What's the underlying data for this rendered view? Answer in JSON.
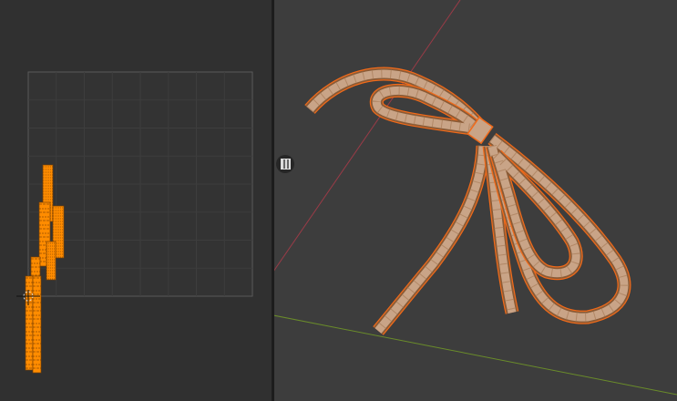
{
  "editors": {
    "left": {
      "type": "uv-editor",
      "background": "#303030",
      "grid_color": "#454545",
      "uv_island_color": "#ff8c00"
    },
    "right": {
      "type": "3d-viewport",
      "background": "#3d3d3d",
      "x_axis_color": "#9a3b47",
      "y_axis_color": "#6a8c2a",
      "mesh_fill": "#c9a487",
      "selection_outline": "#f06a1a"
    }
  },
  "icons": {
    "viewport_overlay_toggle": "checker-texture-icon",
    "cursor": "2d-cursor-icon"
  },
  "colors": {
    "divider": "#1c1c1c"
  }
}
